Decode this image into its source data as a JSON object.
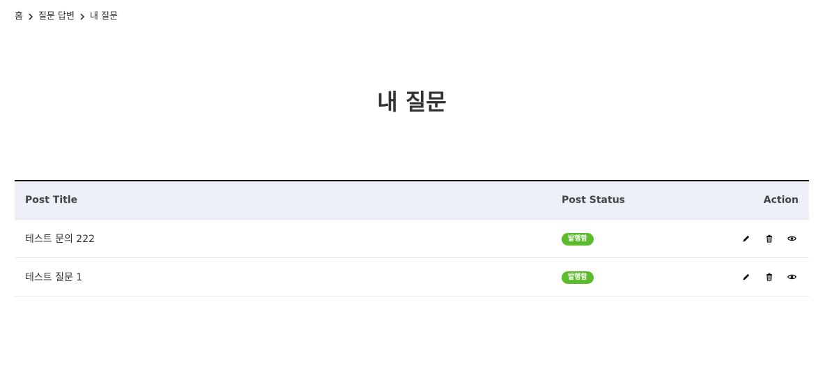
{
  "breadcrumb": {
    "home": "홈",
    "section": "질문 답변",
    "current": "내 질문"
  },
  "page": {
    "title": "내 질문"
  },
  "table": {
    "headers": {
      "title": "Post Title",
      "status": "Post Status",
      "action": "Action"
    },
    "rows": [
      {
        "title": "테스트 문의 222",
        "status": "발행함"
      },
      {
        "title": "테스트 질문 1",
        "status": "발행함"
      }
    ]
  },
  "icons": {
    "edit": "pencil-icon",
    "delete": "trash-icon",
    "view": "eye-icon"
  },
  "colors": {
    "status_badge": "#5bbd2b",
    "header_bg": "#edf0f7",
    "header_top_border": "#1a1a1a"
  }
}
